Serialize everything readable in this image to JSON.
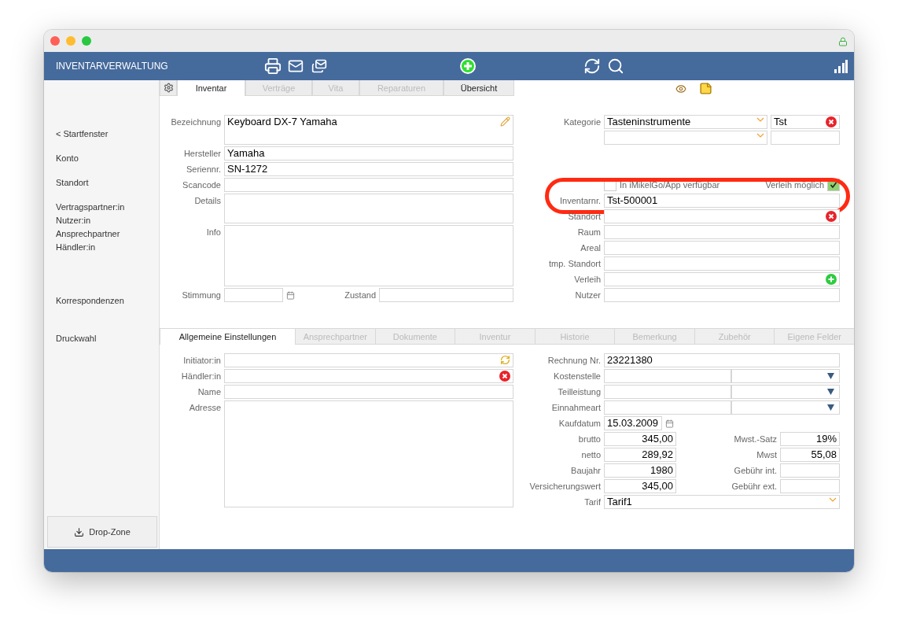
{
  "window": {
    "title": "INVENTARVERWALTUNG"
  },
  "sidebar": {
    "groups": [
      [
        "< Startfenster"
      ],
      [
        "Konto"
      ],
      [
        "Standort"
      ],
      [
        "Vertragspartner:in",
        "Nutzer:in",
        "Ansprechpartner",
        "Händler:in"
      ],
      [
        "Korrespondenzen"
      ],
      [
        "Druckwahl"
      ]
    ],
    "drop_zone": "Drop-Zone"
  },
  "top_tabs": [
    {
      "label": "Inventar",
      "selected": true,
      "disabled": false
    },
    {
      "label": "Verträge",
      "selected": false,
      "disabled": true
    },
    {
      "label": "Vita",
      "selected": false,
      "disabled": true
    },
    {
      "label": "Reparaturen",
      "selected": false,
      "disabled": true
    },
    {
      "label": "Übersicht",
      "selected": false,
      "disabled": false
    }
  ],
  "left_fields": [
    {
      "label": "Bezeichnung",
      "value": "Keyboard DX-7 Yamaha",
      "kind": "tall"
    },
    {
      "label": "Hersteller",
      "value": "Yamaha",
      "kind": "line"
    },
    {
      "label": "Seriennr.",
      "value": "SN-1272",
      "kind": "line"
    },
    {
      "label": "Scancode",
      "kind": "line"
    },
    {
      "label": "Details",
      "kind": "tall"
    },
    {
      "label": "Info",
      "kind": "area"
    }
  ],
  "tuning": {
    "label": "Stimmung"
  },
  "condition": {
    "label": "Zustand"
  },
  "category": {
    "label": "Kategorie",
    "value": "Tasteninstrumente",
    "code": "Tst"
  },
  "checkboxes": [
    {
      "label": "In iMikelGo/App verfügbar",
      "checked": false
    },
    {
      "label": "Verleih möglich",
      "checked": true
    }
  ],
  "right_fields": [
    {
      "label": "Inventarnr.",
      "value": "Tst-500001",
      "highlighted": true
    },
    {
      "label": "Standort"
    },
    {
      "label": "Raum"
    },
    {
      "label": "Areal"
    },
    {
      "label": "tmp. Standort"
    },
    {
      "label": "Verleih"
    },
    {
      "label": "Nutzer"
    }
  ],
  "bottom_tabs": [
    {
      "label": "Allgemeine Einstellungen",
      "selected": true
    },
    {
      "label": "Ansprechpartner",
      "selected": false
    },
    {
      "label": "Dokumente",
      "selected": false
    },
    {
      "label": "Inventur",
      "selected": false
    },
    {
      "label": "Historie",
      "selected": false
    },
    {
      "label": "Bemerkung",
      "selected": false
    },
    {
      "label": "Zubehör",
      "selected": false
    },
    {
      "label": "Eigene Felder",
      "selected": false
    }
  ],
  "contact_fields": [
    {
      "label": "Initiator:in",
      "kind": "line"
    },
    {
      "label": "Händler:in",
      "kind": "line"
    },
    {
      "label": "Name",
      "kind": "line"
    },
    {
      "label": "Adresse",
      "kind": "address"
    }
  ],
  "invoice": {
    "label": "Rechnung Nr.",
    "value": "23221380"
  },
  "split_selects": [
    {
      "label": "Kostenstelle"
    },
    {
      "label": "Teilleistung"
    },
    {
      "label": "Einnahmeart"
    }
  ],
  "purchase_date": {
    "label": "Kaufdatum",
    "value": "15.03.2009"
  },
  "amounts": [
    {
      "label": "brutto",
      "value": "345,00",
      "label_2": "Mwst.-Satz",
      "value_2": "19%"
    },
    {
      "label": "netto",
      "value": "289,92",
      "label_2": "Mwst",
      "value_2": "55,08"
    },
    {
      "label": "Baujahr",
      "value": "1980",
      "label_2": "Gebühr int."
    },
    {
      "label": "Versicherungswert",
      "value": "345,00",
      "label_2": "Gebühr ext."
    }
  ],
  "tariff": {
    "label": "Tarif",
    "value": "Tarif1"
  }
}
